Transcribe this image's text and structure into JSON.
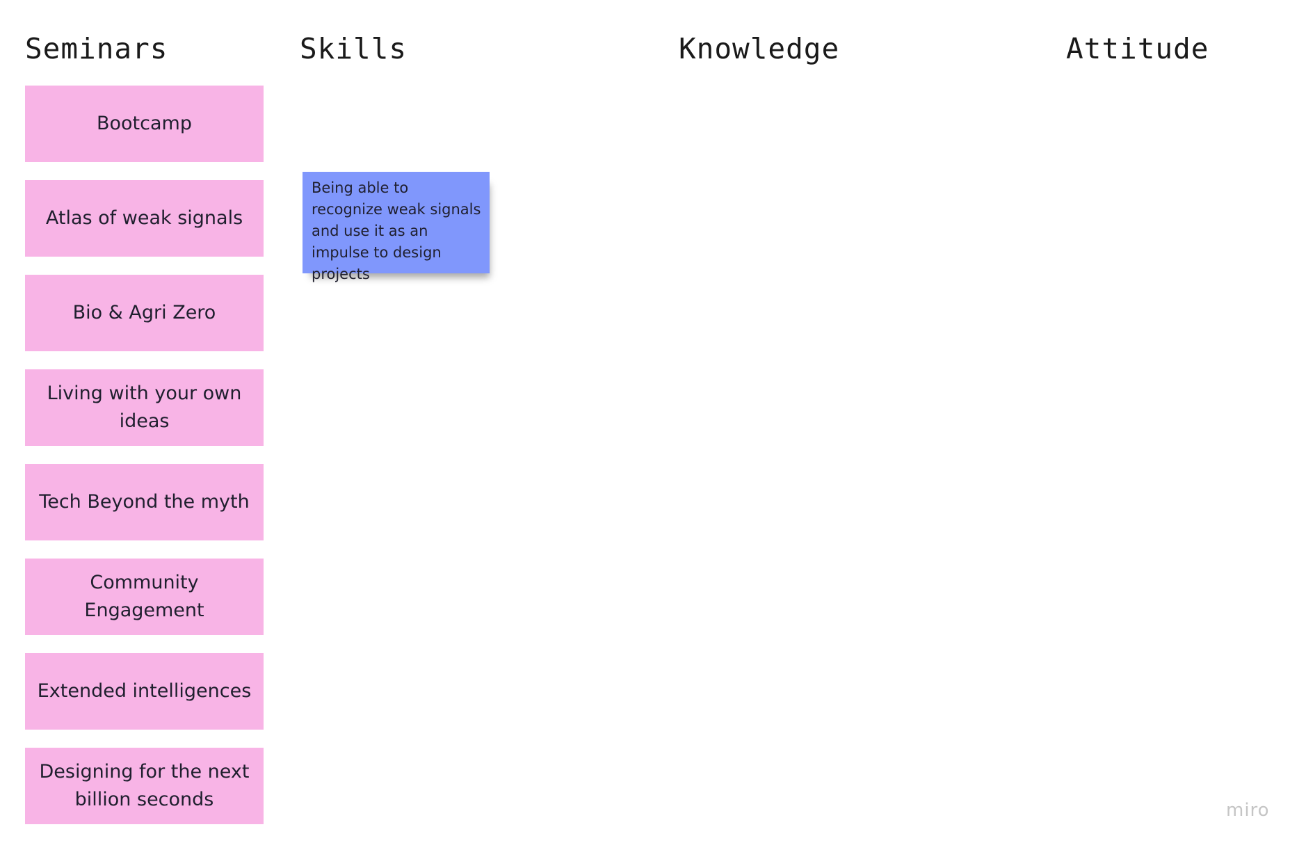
{
  "colors": {
    "sticky_pink": "#f8b4e6",
    "sticky_blue": "#8097fc",
    "watermark": "#c5c5c5"
  },
  "columns": {
    "seminars": "Seminars",
    "skills": "Skills",
    "knowledge": "Knowledge",
    "attitude": "Attitude"
  },
  "seminars": [
    "Bootcamp",
    "Atlas of weak signals",
    "Bio & Agri Zero",
    "Living with your own ideas",
    "Tech Beyond the myth",
    "Community Engagement",
    "Extended intelligences",
    "Designing for the next billion seconds"
  ],
  "skills_note": "Being able to recognize weak signals and use it as an impulse to design projects",
  "watermark": "miro"
}
